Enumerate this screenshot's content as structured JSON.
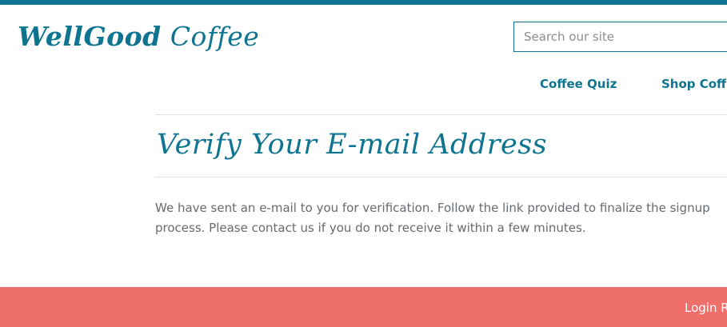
{
  "colors": {
    "brand": "#0e7490",
    "footer": "#ef6f6a",
    "body_text": "#666b70",
    "divider": "#e3e3e3"
  },
  "header": {
    "logo_bold": "WellGood",
    "logo_light": " Coffee",
    "search_placeholder": "Search our site"
  },
  "nav": {
    "items": [
      {
        "label": "Coffee Quiz"
      },
      {
        "label": "Shop Coffe"
      }
    ]
  },
  "main": {
    "title": "Verify Your E-mail Address",
    "message": "We have sent an e-mail to you for verification. Follow the link provided to finalize the signup process. Please contact us if you do not receive it within a few minutes."
  },
  "footer": {
    "link_label": "Login R"
  }
}
